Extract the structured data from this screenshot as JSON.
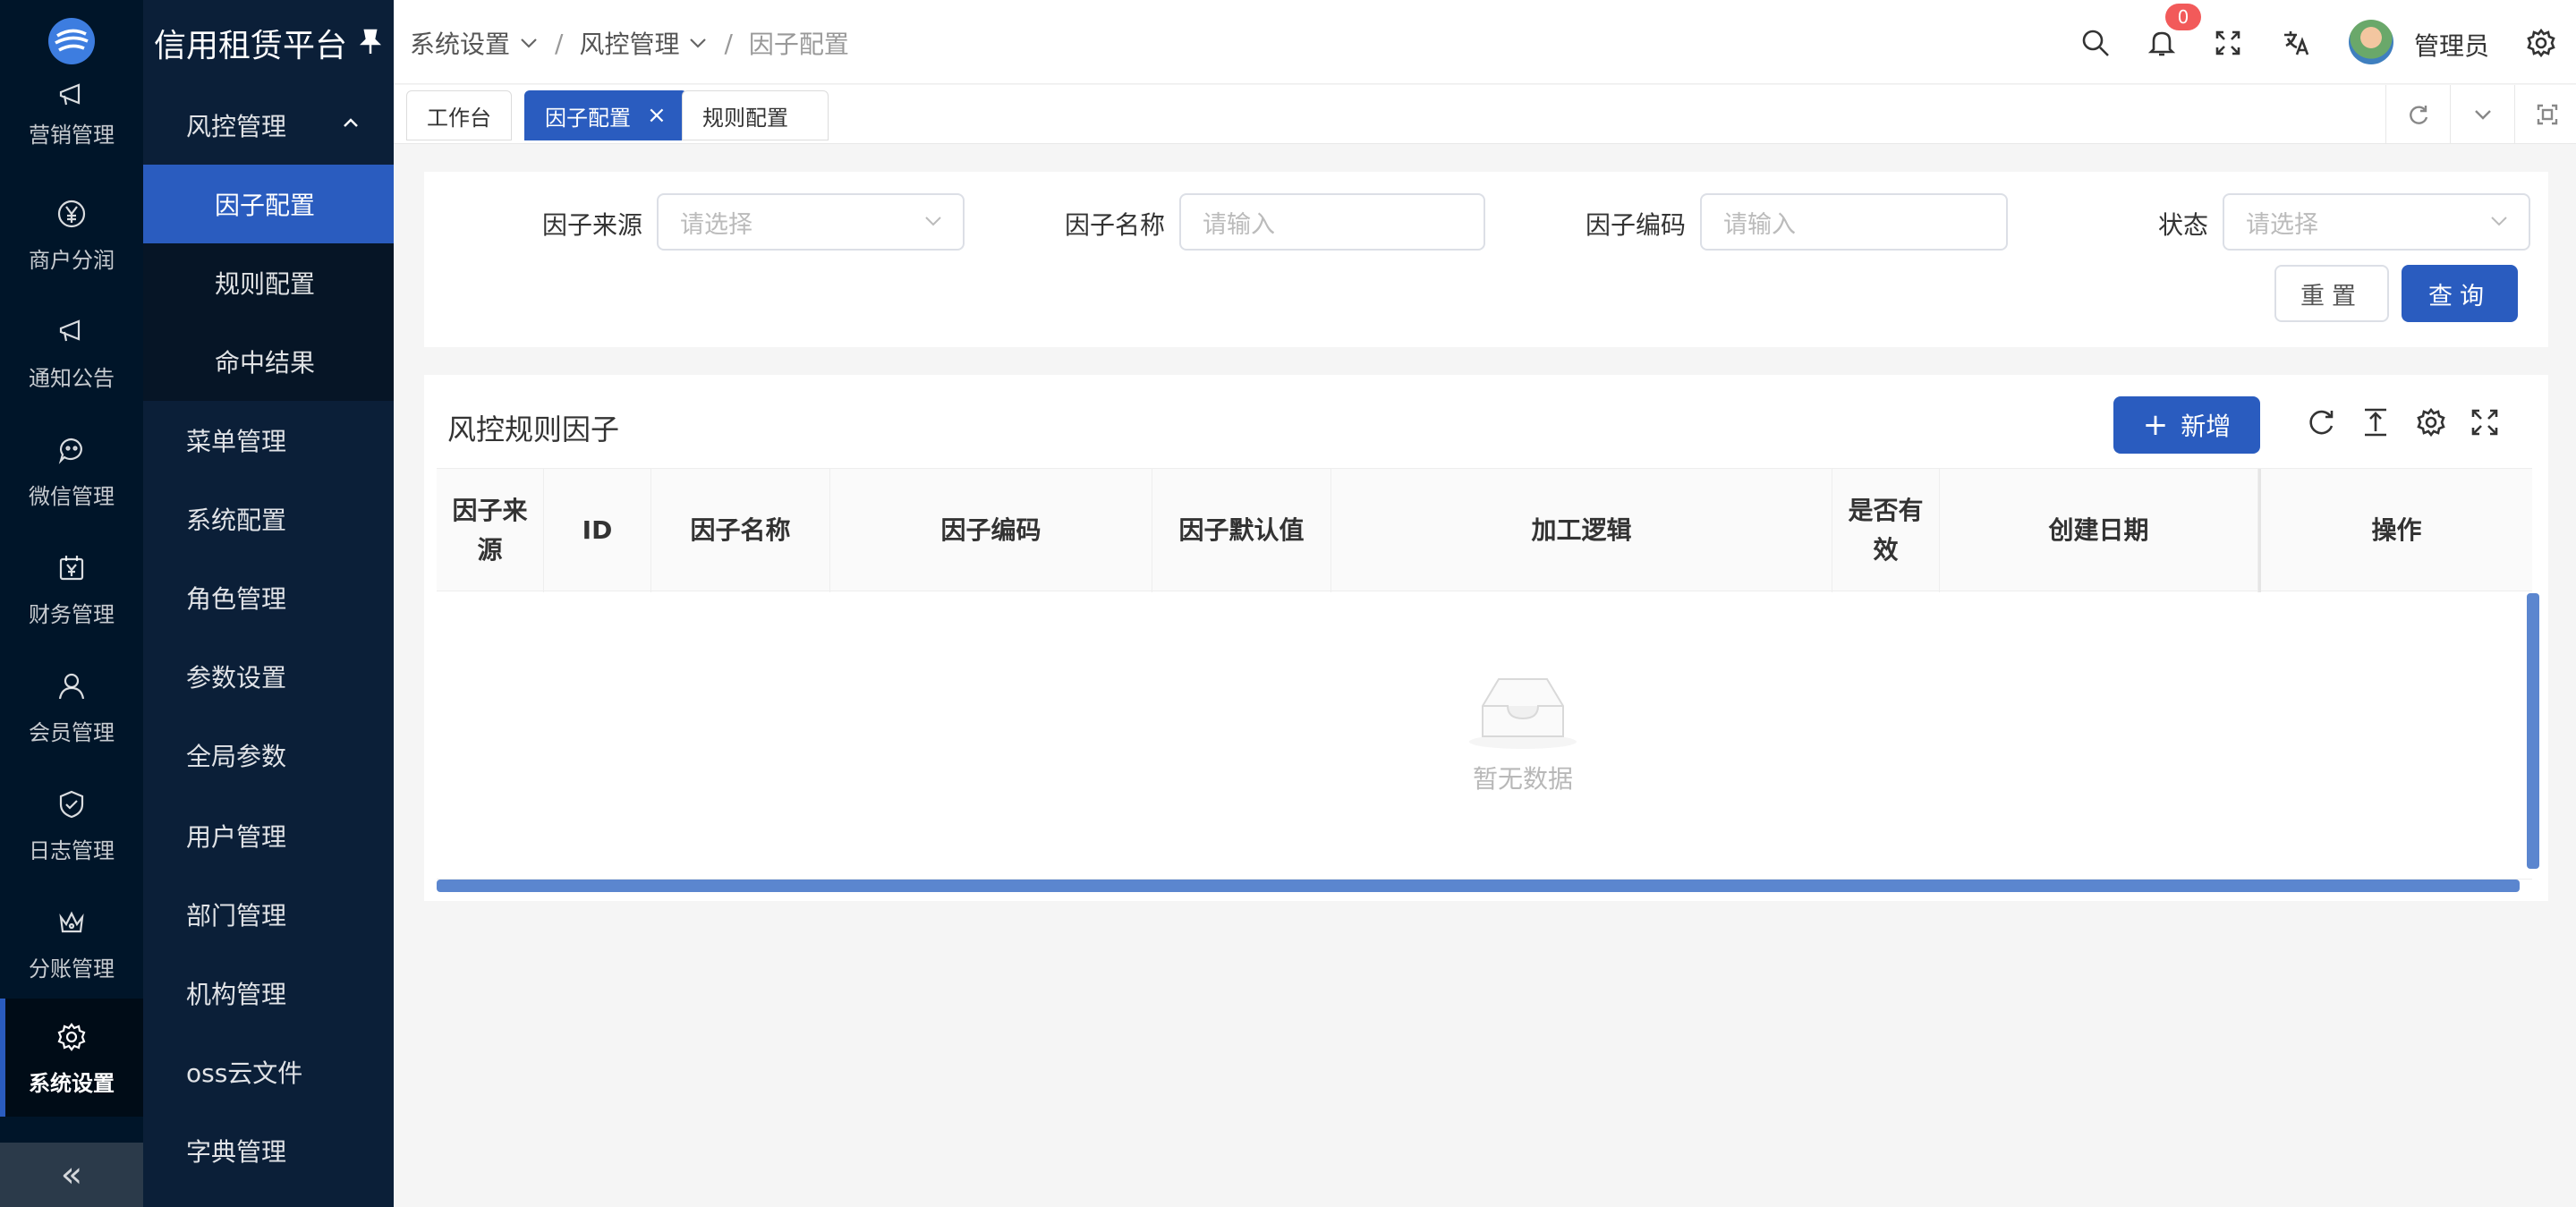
{
  "app": {
    "title": "信用租赁平台"
  },
  "rail": {
    "items": [
      {
        "label": "营销管理",
        "icon": "megaphone-icon"
      },
      {
        "label": "商户分润",
        "icon": "yen-circle-icon"
      },
      {
        "label": "通知公告",
        "icon": "megaphone-icon"
      },
      {
        "label": "微信管理",
        "icon": "wechat-icon"
      },
      {
        "label": "财务管理",
        "icon": "calendar-yen-icon"
      },
      {
        "label": "会员管理",
        "icon": "user-icon"
      },
      {
        "label": "日志管理",
        "icon": "shield-check-icon"
      },
      {
        "label": "分账管理",
        "icon": "crown-icon"
      },
      {
        "label": "系统设置",
        "icon": "gear-icon",
        "active": true
      }
    ],
    "collapse": "«"
  },
  "submenu": {
    "group": {
      "label": "风控管理",
      "children": [
        "因子配置",
        "规则配置",
        "命中结果"
      ],
      "active_child": "因子配置"
    },
    "items": [
      "菜单管理",
      "系统配置",
      "角色管理",
      "参数设置",
      "全局参数",
      "用户管理",
      "部门管理",
      "机构管理",
      "oss云文件",
      "字典管理"
    ]
  },
  "header": {
    "breadcrumbs": [
      "系统设置",
      "风控管理",
      "因子配置"
    ],
    "notification_count": "0",
    "username": "管理员"
  },
  "tabs": [
    {
      "label": "工作台",
      "active": false
    },
    {
      "label": "因子配置",
      "active": true,
      "closable": true,
      "close": "×"
    },
    {
      "label": "规则配置",
      "active": false
    }
  ],
  "search": {
    "fields": [
      {
        "label": "因子来源",
        "placeholder": "请选择",
        "type": "select"
      },
      {
        "label": "因子名称",
        "placeholder": "请输入",
        "type": "input"
      },
      {
        "label": "因子编码",
        "placeholder": "请输入",
        "type": "input"
      },
      {
        "label": "状态",
        "placeholder": "请选择",
        "type": "select"
      }
    ],
    "reset_label": "重置",
    "query_label": "查询"
  },
  "table": {
    "title": "风控规则因子",
    "add_label": "新增",
    "add_symbol": "+",
    "columns": [
      "因子来源",
      "ID",
      "因子名称",
      "因子编码",
      "因子默认值",
      "加工逻辑",
      "是否有效",
      "创建日期",
      "操作"
    ],
    "rows": [],
    "empty_text": "暂无数据"
  },
  "colors": {
    "sidebar": "#001529",
    "submenu": "#0b1f38",
    "accent": "#2a5cbf",
    "badge": "#f25a5a"
  }
}
